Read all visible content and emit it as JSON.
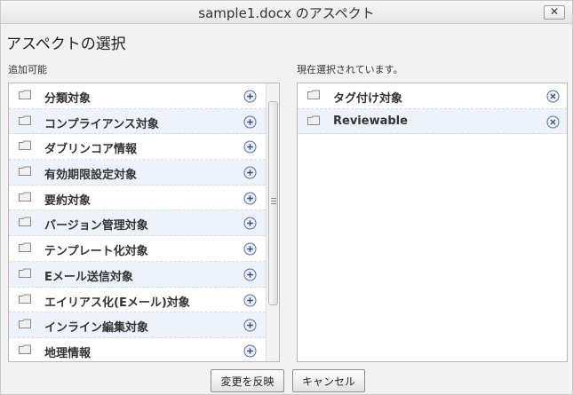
{
  "window": {
    "title": "sample1.docx のアスペクト",
    "close_label": "✕"
  },
  "heading": "アスペクトの選択",
  "available": {
    "label": "追加可能",
    "items": [
      {
        "label": "分類対象"
      },
      {
        "label": "コンプライアンス対象"
      },
      {
        "label": "ダブリンコア情報"
      },
      {
        "label": "有効期限設定対象"
      },
      {
        "label": "要約対象"
      },
      {
        "label": "バージョン管理対象"
      },
      {
        "label": "テンプレート化対象"
      },
      {
        "label": "Eメール送信対象"
      },
      {
        "label": "エイリアス化(Eメール)対象"
      },
      {
        "label": "インライン編集対象"
      },
      {
        "label": "地理情報"
      }
    ]
  },
  "selected": {
    "label": "現在選択されています。",
    "items": [
      {
        "label": "タグ付け対象"
      },
      {
        "label": "Reviewable"
      }
    ]
  },
  "buttons": {
    "apply": "変更を反映",
    "cancel": "キャンセル"
  }
}
